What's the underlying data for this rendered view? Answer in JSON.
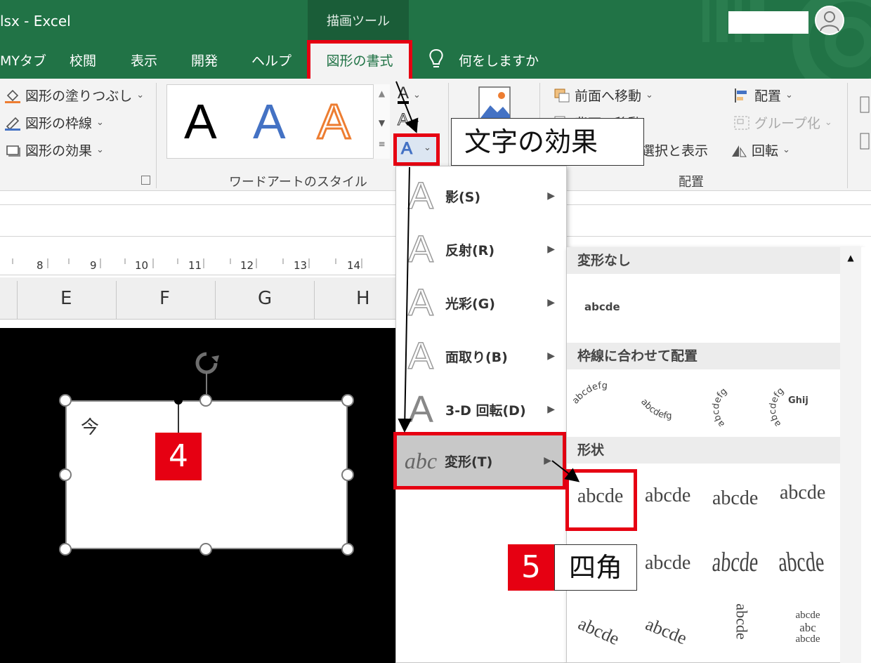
{
  "titlebar": {
    "title": "lsx - Excel",
    "context_tab": "描画ツール"
  },
  "tabs": [
    {
      "label": "MYタブ"
    },
    {
      "label": "校閲"
    },
    {
      "label": "表示"
    },
    {
      "label": "開発"
    },
    {
      "label": "ヘルプ"
    },
    {
      "label": "図形の書式"
    },
    {
      "label": "何をしますか"
    }
  ],
  "ribbon": {
    "shape_styles": {
      "fill": "図形の塗りつぶし",
      "outline": "図形の枠線",
      "effects": "図形の効果"
    },
    "wordart": {
      "letter": "A",
      "group_label": "ワードアートのスタイル"
    },
    "arrange": {
      "bring_forward": "前面へ移動",
      "send_backward": "背面へ移動",
      "selection_pane": "オブジェクトの選択と表示",
      "align": "配置",
      "group": "グループ化",
      "rotate": "回転",
      "group_label": "配置"
    }
  },
  "ruler": {
    "marks": [
      "8",
      "9",
      "10",
      "11",
      "12",
      "13",
      "14"
    ]
  },
  "columns": [
    "E",
    "F",
    "G",
    "H"
  ],
  "shape": {
    "text": "今"
  },
  "effects_menu": {
    "items": [
      {
        "label": "影(S)"
      },
      {
        "label": "反射(R)"
      },
      {
        "label": "光彩(G)"
      },
      {
        "label": "面取り(B)"
      },
      {
        "label": "3-D 回転(D)"
      },
      {
        "label": "変形(T)",
        "glyph": "abc"
      }
    ]
  },
  "transform_gallery": {
    "sections": {
      "none": "変形なし",
      "follow_path": "枠線に合わせて配置",
      "warp": "形状"
    },
    "sample": "abcde",
    "sample_path": "abcdefg",
    "sample_button": "Ghij",
    "sample_stack": "abc"
  },
  "callouts": {
    "text_effects": "文字の効果",
    "step4": "4",
    "step5": "5",
    "square": "四角"
  },
  "colors": {
    "excel_green": "#217346",
    "highlight_red": "#e60012",
    "wordart_blue": "#4472c4",
    "wordart_orange": "#ed7d31"
  }
}
